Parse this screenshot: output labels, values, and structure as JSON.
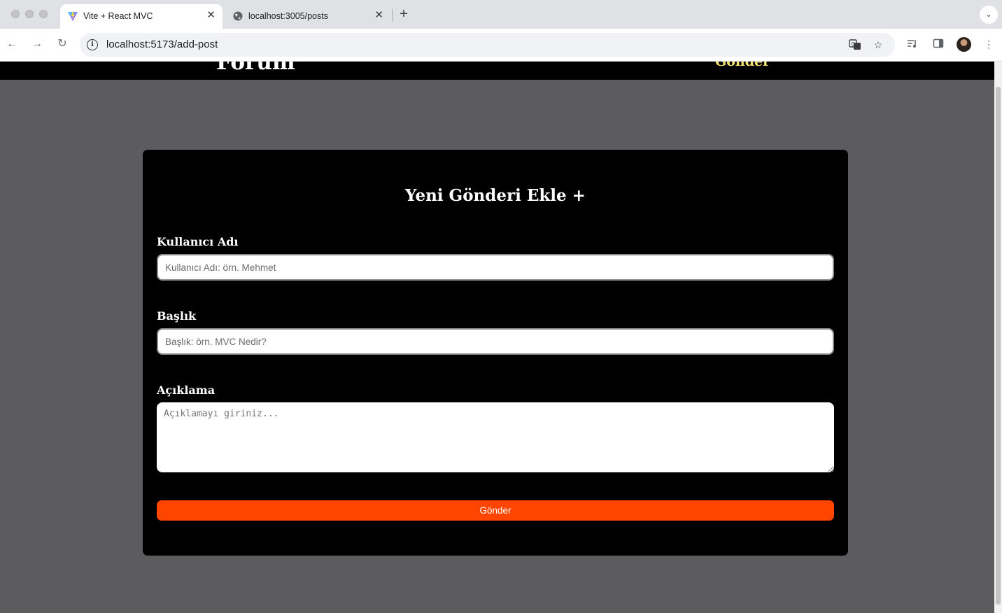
{
  "browser": {
    "tabs": [
      {
        "title": "Vite + React MVC",
        "active": true,
        "favicon": "vite-logo-icon"
      },
      {
        "title": "localhost:3005/posts",
        "active": false,
        "favicon": "globe-icon"
      }
    ],
    "address": "localhost:5173/add-post",
    "icons": {
      "back": "back-arrow-icon",
      "forward": "forward-arrow-icon",
      "reload": "reload-icon",
      "site_info": "info-icon",
      "translate": "translate-icon",
      "bookmark": "star-icon",
      "media": "media-control-icon",
      "side_panel": "side-panel-icon",
      "menu": "kebab-menu-icon"
    }
  },
  "site": {
    "brand": "Forum",
    "nav_link": "Gönder"
  },
  "form": {
    "title": "Yeni Gönderi Ekle +",
    "username_label": "Kullanıcı Adı",
    "username_placeholder": "Kullanıcı Adı: örn. Mehmet",
    "title_label": "Başlık",
    "title_placeholder": "Başlık: örn. MVC Nedir?",
    "description_label": "Açıklama",
    "description_placeholder": "Açıklamayı giriniz...",
    "submit_label": "Gönder"
  },
  "colors": {
    "page_bg": "#5c5c5f",
    "card_bg": "#000000",
    "accent": "#ff4500",
    "nav_link": "#f1e36b"
  }
}
